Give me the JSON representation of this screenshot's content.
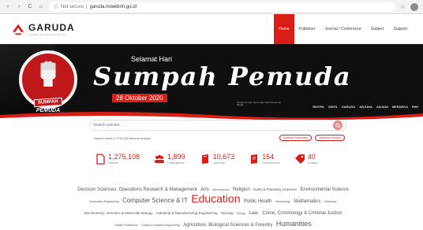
{
  "browser": {
    "back": "‹",
    "forward": "›",
    "reload": "C",
    "home": "⌂",
    "security": "Not secure",
    "url": "garuda.ristekbrin.go.id"
  },
  "header": {
    "logo_title": "GARUDA",
    "logo_subtitle": "GARBA RUJUKAN DIGITAL",
    "menu": [
      "Home",
      "Publisher",
      "Journal / Conference",
      "Subject",
      "Support"
    ]
  },
  "banner": {
    "greeting": "Selamat Hari",
    "headline": "Sumpah Pemuda",
    "date": "28 Oktober 2020",
    "stamp_line1": "SUMPAH",
    "stamp_line2": "PEMUDA",
    "fine_print": "Sumpah Pemuda, Satu Pusaka Sakti. Bersatu dan Bangkit.",
    "partners": [
      "RISTEK",
      "SINTA",
      "GARUDA",
      "ARJUNA",
      "ANJANI",
      "MERDEKA",
      "RIIN"
    ]
  },
  "search": {
    "placeholder": "Search articles...",
    "summary": "Search within 1,275,108 indexed articles",
    "advanced": "Advance Publication",
    "advanced2": "Advanced Search"
  },
  "stats": [
    {
      "value": "1,275,108",
      "label": "Articles",
      "icon": "document-icon"
    },
    {
      "value": "1,899",
      "label": "Publications",
      "icon": "people-icon"
    },
    {
      "value": "10,673",
      "label": "Journals",
      "icon": "journal-icon"
    },
    {
      "value": "154",
      "label": "Conferences",
      "icon": "book-icon"
    },
    {
      "value": "40",
      "label": "Subject",
      "icon": "tag-icon"
    }
  ],
  "cloud": {
    "row1": [
      "Decision Sciences, Operations Research & Management",
      "Arts",
      "Neuroscience",
      "Religion",
      "Earth & Planetary Sciences",
      "Environmental Science"
    ],
    "row2": [
      "Automotive Engineering",
      "Computer Science & IT",
      "Education",
      "Public Health",
      "Immunology",
      "Mathematics",
      "Veterinary"
    ],
    "row3": [
      "Biochemistry, Genetics & Molecular Biology",
      "Industrial & Manufacturing Engineering",
      "Nursing",
      "Energy",
      "Law,",
      "Crime, Criminology & Criminal Justice"
    ],
    "row4": [
      "Health Professions",
      "Control & Systems Engineering",
      "Agriculture, Biological Sciences & Forestry",
      "Humanities"
    ]
  },
  "colors": {
    "brand_red": "#d91e18",
    "banner_bg": "#0f0f0f"
  }
}
